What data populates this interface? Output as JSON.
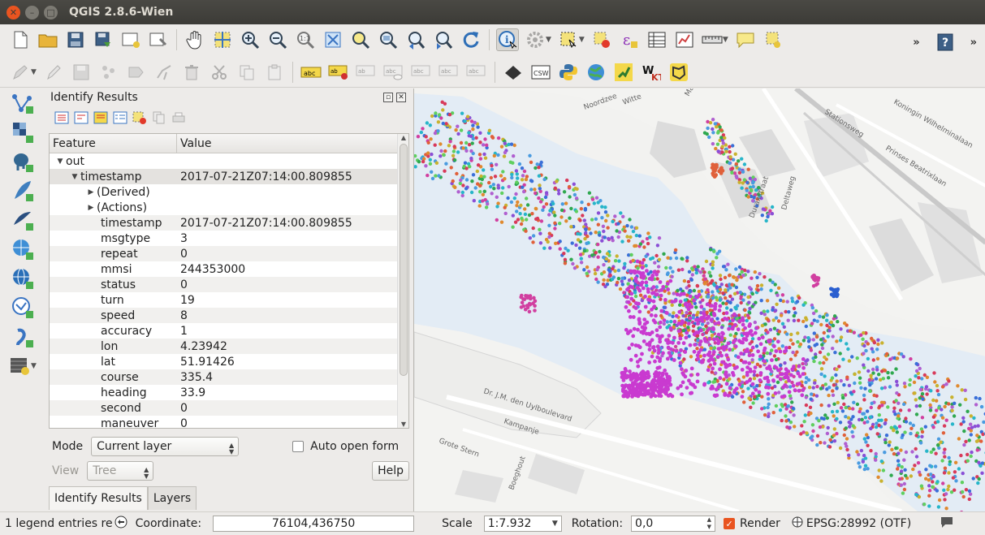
{
  "window": {
    "title": "QGIS 2.8.6-Wien"
  },
  "toolbar": {
    "overflow": "»"
  },
  "panel": {
    "title": "Identify Results",
    "columns": [
      "Feature",
      "Value"
    ],
    "tree": {
      "layer": "out",
      "feature_key": "timestamp",
      "feature_value": "2017-07-21Z07:14:00.809855",
      "derived": "(Derived)",
      "actions": "(Actions)",
      "attributes": [
        {
          "key": "timestamp",
          "value": "2017-07-21Z07:14:00.809855"
        },
        {
          "key": "msgtype",
          "value": "3"
        },
        {
          "key": "repeat",
          "value": "0"
        },
        {
          "key": "mmsi",
          "value": "244353000"
        },
        {
          "key": "status",
          "value": "0"
        },
        {
          "key": "turn",
          "value": "19"
        },
        {
          "key": "speed",
          "value": "8"
        },
        {
          "key": "accuracy",
          "value": "1"
        },
        {
          "key": "lon",
          "value": "4.23942"
        },
        {
          "key": "lat",
          "value": "51.91426"
        },
        {
          "key": "course",
          "value": "335.4"
        },
        {
          "key": "heading",
          "value": "33.9"
        },
        {
          "key": "second",
          "value": "0"
        },
        {
          "key": "maneuver",
          "value": "0"
        }
      ]
    },
    "mode_label": "Mode",
    "mode_value": "Current layer",
    "auto_open_label": "Auto open form",
    "view_label": "View",
    "view_value": "Tree",
    "help_label": "Help",
    "tabs": [
      "Identify Results",
      "Layers"
    ]
  },
  "map": {
    "labels": {
      "stationsweg": "Stationsweg",
      "koningin": "Koningin Wilhelminalaan",
      "prinses": "Prinses Beatrixlaan",
      "duraxstraat": "Duraxstraat",
      "deltaweg": "Deltaweg",
      "uylboulevard": "Dr. J.M. den Uylboulevard",
      "kampanje": "Kampanje",
      "grote_stern": "Grote Stern",
      "boeghout": "Boeghout",
      "wilte": "Witte",
      "noordzee": "Noordzee",
      "ma": "Ma"
    }
  },
  "status": {
    "legend_text": "1 legend entries re",
    "coordinate_label": "Coordinate:",
    "coordinate_value": "76104,436750",
    "scale_label": "Scale",
    "scale_value": "1:7.932",
    "rotation_label": "Rotation:",
    "rotation_value": "0,0",
    "render_label": "Render",
    "crs_label": "EPSG:28992 (OTF)"
  }
}
